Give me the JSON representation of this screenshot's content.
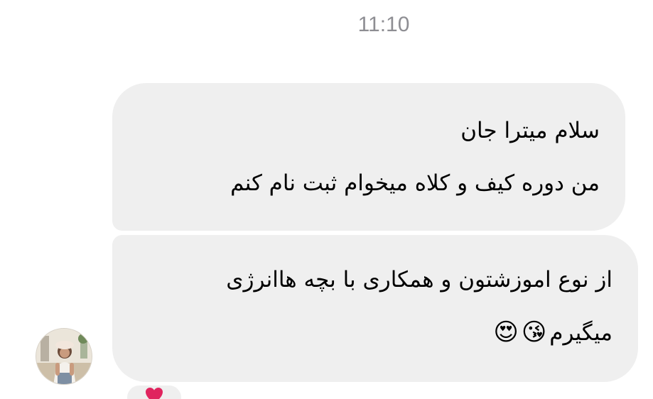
{
  "status": {
    "time": "11:10"
  },
  "messages": [
    {
      "lines": [
        "سلام میترا جان",
        "من دوره کیف و کلاه میخوام ثبت نام کنم"
      ]
    },
    {
      "lines": [
        "از نوع اموزشتون و همکاری با بچه هاانرژی",
        "میگیرم"
      ],
      "emojis": [
        "😘",
        "😍"
      ]
    }
  ],
  "reaction": {
    "icon": "heart-icon",
    "color": "#e0245e"
  },
  "avatar": {
    "icon": "avatar-photo"
  },
  "colors": {
    "bubble": "#efefef",
    "timestamp": "#8e8e93"
  }
}
